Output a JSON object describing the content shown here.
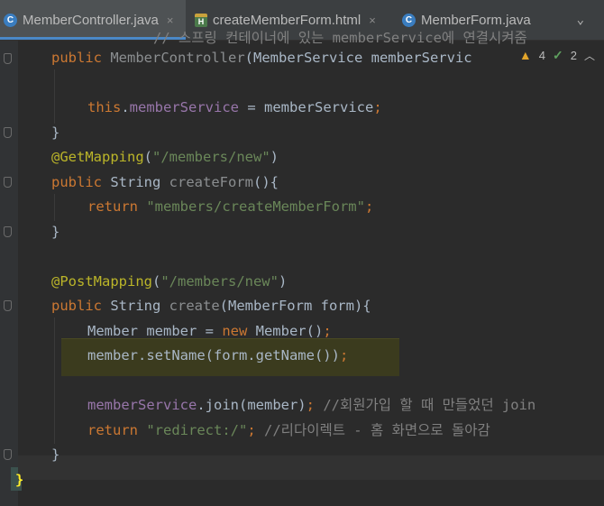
{
  "tabs": [
    {
      "label": "MemberController.java",
      "icon": "java-class-icon",
      "active": true
    },
    {
      "label": "createMemberForm.html",
      "icon": "html-file-icon",
      "active": false
    },
    {
      "label": "MemberForm.java",
      "icon": "java-class-icon",
      "active": false
    }
  ],
  "tab_icons": {
    "java": "C",
    "html": "H"
  },
  "close_glyph": "×",
  "menu_caret": "⌄",
  "inspection": {
    "warnings": "4",
    "ok": "2"
  },
  "code": {
    "top_comment": "// 스프링 컨테이너에 있는 memberService에 연결시켜줌",
    "constructor_kw": "public",
    "constructor_name": "MemberController",
    "constructor_params": "(MemberService memberServic",
    "this_kw": "this",
    "this_field": "memberService",
    "this_rest": " = memberService",
    "semicolon": ";",
    "close_brace": "}",
    "get_mapping": "@GetMapping",
    "get_path": "\"/members/new\"",
    "public_kw": "public",
    "string_type": " String ",
    "create_form_name": "createForm",
    "create_form_rest": "(){",
    "return_kw": "return",
    "create_form_return": "\"members/createMemberForm\"",
    "post_mapping": "@PostMapping",
    "post_path": "\"/members/new\"",
    "create_name": "create",
    "create_params": "(MemberForm form){",
    "member_decl": "Member member = ",
    "new_kw": "new",
    "member_ctor": " Member()",
    "set_name_line": "member.setName(form.getName())",
    "member_service_field": "memberService",
    "join_call": ".join(member)",
    "join_comment": "//회원가입 할 때 만들었던 join",
    "redirect_str": "\"redirect:/\"",
    "redirect_comment": "//리다이렉트 - 홈 화면으로 돌아감",
    "open_paren": "(",
    "close_paren": ")",
    "final_brace": "}"
  }
}
